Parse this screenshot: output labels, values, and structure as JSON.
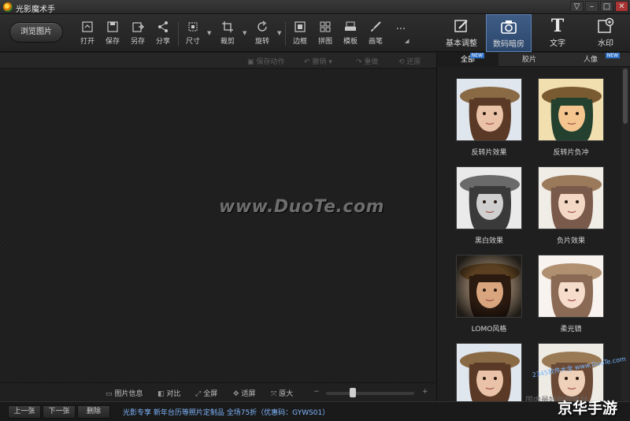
{
  "window": {
    "title": "光影魔术手",
    "controls": [
      "▽",
      "–",
      "□",
      "✕"
    ]
  },
  "toolbar": {
    "browse": "浏览图片",
    "tools": [
      {
        "label": "打开",
        "icon": "open-icon"
      },
      {
        "label": "保存",
        "icon": "save-icon"
      },
      {
        "label": "另存",
        "icon": "save-as-icon"
      },
      {
        "label": "分享",
        "icon": "share-icon"
      },
      {
        "label": "尺寸",
        "icon": "resize-icon"
      },
      {
        "label": "裁剪",
        "icon": "crop-icon"
      },
      {
        "label": "旋转",
        "icon": "rotate-icon"
      },
      {
        "label": "边框",
        "icon": "border-icon"
      },
      {
        "label": "拼图",
        "icon": "collage-icon"
      },
      {
        "label": "模板",
        "icon": "template-icon"
      },
      {
        "label": "画笔",
        "icon": "brush-icon"
      },
      {
        "label": "...",
        "icon": "more-icon"
      }
    ],
    "modes": [
      {
        "label": "基本调整",
        "icon": "basic-adjust-icon"
      },
      {
        "label": "数码暗房",
        "icon": "darkroom-icon"
      },
      {
        "label": "文字",
        "icon": "text-icon"
      },
      {
        "label": "水印",
        "icon": "watermark-icon"
      }
    ]
  },
  "canvas": {
    "top_actions": [
      "保存动作",
      "撤销",
      "重做",
      "还原"
    ],
    "watermark": "www.DuoTe.com",
    "bottom_actions": [
      "图片信息",
      "对比",
      "全屏",
      "适屏",
      "原大"
    ],
    "zoom_minus": "−",
    "zoom_plus": "+",
    "zoom_level": 0.3
  },
  "panel": {
    "tabs": [
      {
        "label": "全部",
        "badge": "NEW"
      },
      {
        "label": "胶片",
        "badge": ""
      },
      {
        "label": "人像",
        "badge": "NEW"
      }
    ],
    "effects": [
      {
        "label": "反转片效果"
      },
      {
        "label": "反转片负冲"
      },
      {
        "label": "黑白效果"
      },
      {
        "label": "负片效果"
      },
      {
        "label": "LOMO风格"
      },
      {
        "label": "柔光镜"
      },
      {
        "label": ""
      },
      {
        "label": ""
      }
    ],
    "footer_text": "国内最好的软件站"
  },
  "statusbar": {
    "prev": "上一张",
    "next": "下一张",
    "delete": "删除",
    "promo": "光影专享 新年台历等照片定制品 全场75折（优惠码：GYWS01）"
  },
  "overlay": {
    "corner_text": "京华手游",
    "ribbon": "2345软件大全 www.DuoTe.com"
  }
}
